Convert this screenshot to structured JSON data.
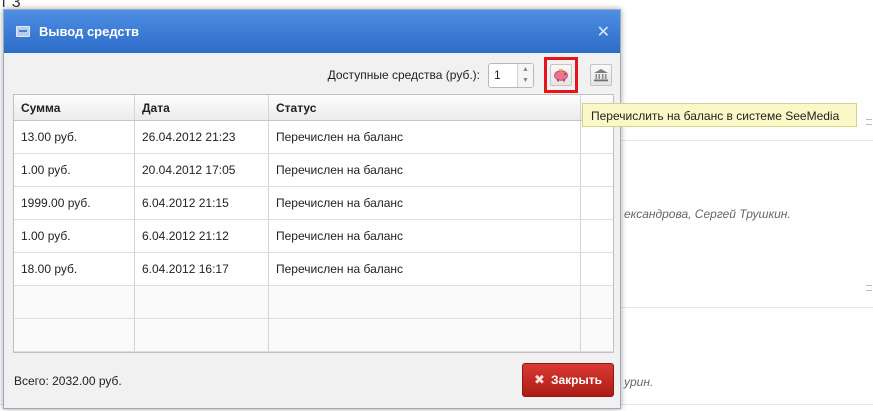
{
  "background": {
    "top_fragment": "т 3",
    "names_fragment": "ександрова, Сергей Трушкин.",
    "names_fragment2": "урин."
  },
  "dialog": {
    "title": "Вывод средств",
    "title_icon": "wallet-icon",
    "close_glyph": "✕",
    "funds_label": "Доступные средства (руб.):",
    "funds_value": "1",
    "transfer_icon": "piggy-bank-icon",
    "bank_icon": "bank-icon",
    "tooltip": "Перечислить на баланс в системе SeeMedia",
    "columns": [
      "Сумма",
      "Дата",
      "Статус"
    ],
    "rows": [
      {
        "amount": "13.00 руб.",
        "date": "26.04.2012 21:23",
        "status": "Перечислен на баланс"
      },
      {
        "amount": "1.00 руб.",
        "date": "20.04.2012 17:05",
        "status": "Перечислен на баланс"
      },
      {
        "amount": "1999.00 руб.",
        "date": "6.04.2012 21:15",
        "status": "Перечислен на баланс"
      },
      {
        "amount": "1.00 руб.",
        "date": "6.04.2012 21:12",
        "status": "Перечислен на баланс"
      },
      {
        "amount": "18.00 руб.",
        "date": "6.04.2012 16:17",
        "status": "Перечислен на баланс"
      }
    ],
    "total": "Всего: 2032.00 руб.",
    "close_button_label": "Закрыть",
    "colors": {
      "header": "#3a7bd5",
      "close_button": "#c42a23",
      "highlight": "#e8141c",
      "tooltip_bg": "#fbf8c7"
    }
  }
}
